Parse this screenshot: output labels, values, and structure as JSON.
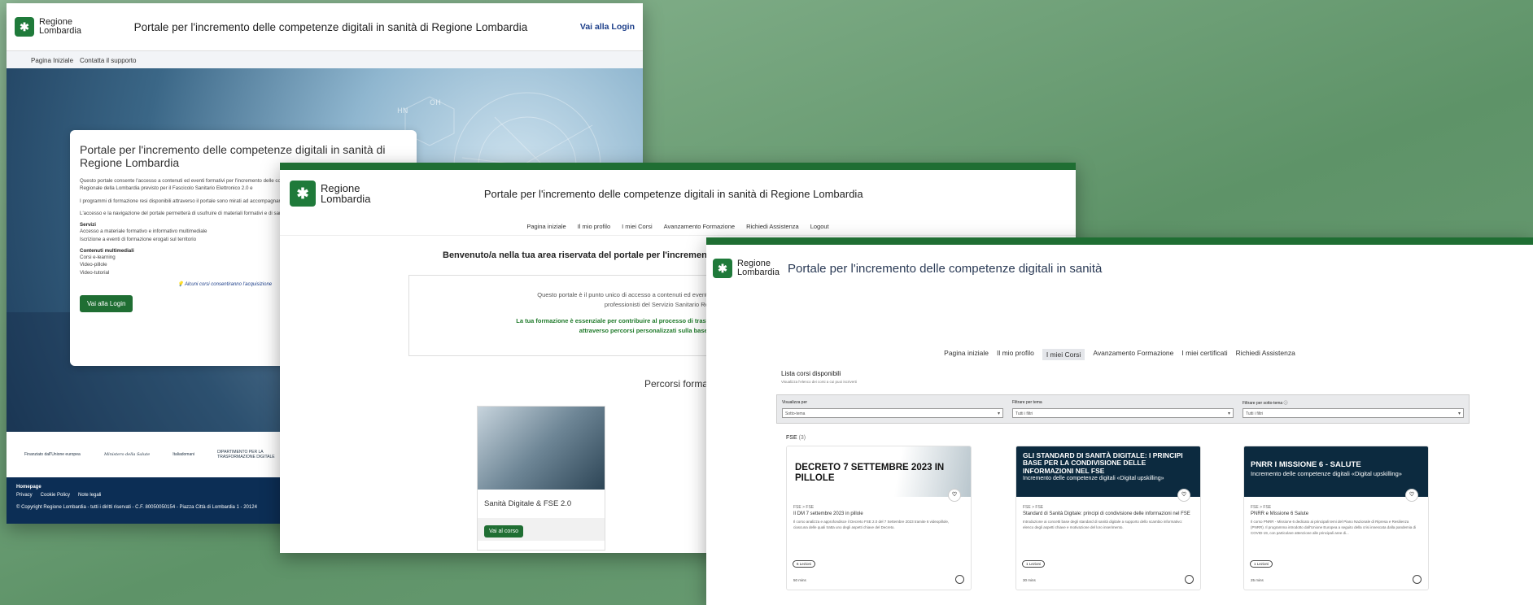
{
  "accent": "#1f6e33",
  "w1": {
    "logo_line1": "Regione",
    "logo_line2": "Lombardia",
    "title": "Portale per l'incremento delle competenze digitali in sanità di Regione Lombardia",
    "login_link": "Vai alla Login",
    "nav": [
      "Pagina Iniziale",
      "Contatta il supporto"
    ],
    "card_title": "Portale per l'incremento delle competenze digitali in sanità di Regione Lombardia",
    "p1": "Questo portale consente l'accesso a contenuti ed eventi formativi per l'incremento delle competenze digitali del personale del Servizio Sanitario Regionale della Lombardia previsto per il Fascicolo Sanitario Elettronico 2.0 e",
    "p2": "I programmi di formazione resi disponibili attraverso il portale sono mirati ad accompagnare il personale con gli strumenti digitali.",
    "p3": "L'accesso e la navigazione del portale permetterà di usufruire di materiali formativi e di sanità digitale!",
    "services_title": "Servizi",
    "services": [
      "Accesso a materiale formativo e informativo multimediale",
      "Iscrizione a eventi di formazione erogati sul territorio"
    ],
    "content_title": "Contenuti multimediali",
    "content_items": [
      "Corsi e-learning",
      "Video-pillole",
      "Video-tutorial"
    ],
    "note": "Alcuni corsi consentiranno l'acquisizione",
    "login_button": "Vai alla Login",
    "logos": [
      "Finanziato dall'Unione europea",
      "Ministero della Salute",
      "Italiadomani",
      "DIPARTIMENTO PER LA TRASFORMAZIONE DIGITALE"
    ],
    "footer_home": "Homepage",
    "footer_links": [
      "Privacy",
      "Cookie Policy",
      "Note legali"
    ],
    "copyright": "© Copyright Regione Lombardia - tutti i diritti riservati - C.F. 80050050154 - Piazza Città di Lombardia 1 - 20124"
  },
  "w2": {
    "logo_line1": "Regione",
    "logo_line2": "Lombardia",
    "title": "Portale per l'incremento delle competenze digitali in sanità di Regione Lombardia",
    "nav": [
      "Pagina iniziale",
      "Il mio profilo",
      "I miei Corsi",
      "Avanzamento Formazione",
      "Richiedi Assistenza",
      "Logout"
    ],
    "welcome": "Benvenuto/a nella tua area riservata del portale per l'incremento del",
    "intro1": "Questo portale è il punto unico di accesso a contenuti ed eventi formativi per l'i",
    "intro2": "professionisti del Servizio Sanitario Regionale della",
    "green1": "La tua formazione è essenziale per contribuire al processo di trasformazione dig",
    "green2": "attraverso percorsi personalizzati sulla base del tuo prof",
    "percorsi": "Percorsi forma",
    "course_title": "Sanità Digitale & FSE 2.0",
    "course_button": "Vai al corso"
  },
  "w3": {
    "logo_line1": "Regione",
    "logo_line2": "Lombardia",
    "title": "Portale per l'incremento delle competenze digitali in sanità",
    "nav": [
      "Pagina iniziale",
      "Il mio profilo",
      "I miei Corsi",
      "Avanzamento Formazione",
      "I miei certificati",
      "Richiedi Assistenza"
    ],
    "active_nav_index": 2,
    "list_title": "Lista corsi disponibili",
    "list_subtitle": "Visualizza l'elenco dei corsi a cui puoi iscriverti",
    "filters": [
      {
        "label": "Visualizza per",
        "value": "Sotto-tema"
      },
      {
        "label": "Filtrare per tema",
        "value": "Tutti i filtri"
      },
      {
        "label": "Filtrare per sotto-tema",
        "value": "Tutti i filtri"
      }
    ],
    "group_label": "FSE",
    "group_count": "(3)",
    "courses": [
      {
        "banner": "DECRETO 7 SETTEMBRE 2023 IN PILLOLE",
        "banner_sub": "",
        "cat": "FSE > FSE",
        "title": "Il DM 7 settembre 2023 in pillole",
        "desc": "Il corso analizza e approfondisce il Decreto FSE 2.0 del 7 Settembre 2023 tramite 6 videopillole, ciascuna delle quali tratta uno degli aspetti chiave del Decreto.",
        "lessons": "6 Lezioni",
        "mins": "50 mins"
      },
      {
        "banner": "GLI STANDARD DI SANITÀ DIGITALE: I PRINCIPI BASE PER LA CONDIVISIONE DELLE INFORMAZIONI NEL FSE",
        "banner_sub": "Incremento delle competenze digitali «Digital upskilling»",
        "cat": "FSE > FSE",
        "title": "Standard di Sanità Digitale: principi di condivisione delle informazioni nel FSE",
        "desc": "Introduzione ai concetti base degli standard di sanità digitale a supporto dello scambio informativo: elenco degli aspetti chiave e motivazione del loro inserimento.",
        "lessons": "1 Lezioni",
        "mins": "30 mins"
      },
      {
        "banner": "PNRR I MISSIONE 6 - SALUTE",
        "banner_sub": "Incremento delle competenze digitali «Digital upskilling»",
        "cat": "FSE > FSE",
        "title": "PNRR e Missione 6 Salute",
        "desc": "Il corso PNRR - Missione 6 dedicato ai principali temi del Piano Nazionale di Ripresa e Resilienza (PNRR). Il programma introdotto dall'Unione Europea a seguito della crisi innescata dalla pandemia di COVID-19, con particolare attenzione alle principali aree di...",
        "lessons": "1 Lezioni",
        "mins": "25 mins"
      }
    ]
  }
}
